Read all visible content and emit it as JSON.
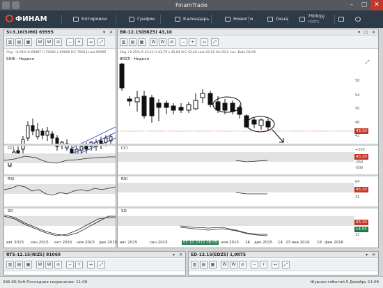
{
  "window": {
    "title": "FinamTrade",
    "min": "–",
    "max": "□",
    "close": "✕"
  },
  "toolbar": {
    "logo": "ФИНАМ",
    "items": [
      "Котировки",
      "График",
      "Календарь",
      "Новости",
      "Окна"
    ],
    "account": {
      "id": "7600qsj",
      "sub": "FORTS"
    }
  },
  "left_panel": {
    "title": "Si-3.16(SIH6) 69995",
    "info": "Chg −0,04%  O 69987  H 70062  L 69608  PrC 70023  Last 69995",
    "series": "SIH6 - Неделя",
    "y_ticks": [],
    "sub1": "CCI",
    "sub2": "RSI",
    "sub3": "SO",
    "x_ticks": [
      "авг 2015",
      "сен 2015",
      "окт 2015",
      "ноя 2015",
      "дек 2015"
    ]
  },
  "main_panel": {
    "title": "BR-12.15(BRZ5) 43,10",
    "info": "Chg +0,25%  O 43,21  H 43,79  L 42,84  PrC 43,26  Last 43,10  Vol 29,2 тыс.  Date 01/49",
    "series": "BRZ5 - Неделя",
    "price_tag": "43,10",
    "y_ticks": [
      "58",
      "54",
      "50",
      "46",
      "42"
    ],
    "sub1": {
      "name": "CCI",
      "ticks": [
        "+250",
        "-250",
        "-500"
      ],
      "tag": "43,10"
    },
    "sub2": {
      "name": "RSI",
      "ticks": [
        "64",
        "31"
      ],
      "tag": "43,10"
    },
    "sub3": {
      "name": "SO",
      "ticks": [
        "12",
        "14,55"
      ],
      "tag": "43,10",
      "tag2": "14,55"
    },
    "x_ticks": [
      "авг 2015",
      "сен 2015",
      "05.10.2015 08:09",
      "ноя 2015",
      "16",
      "дек 2015",
      "14",
      "23 янв 2016",
      "18",
      "фев 2016"
    ]
  },
  "bottom_left": {
    "title": "RTS-12.15(RIZ5) 81060"
  },
  "bottom_right": {
    "title": "ED-12.15(EDZ5) 1,0875"
  },
  "tool_labels": [
    "W",
    "W",
    "⊘",
    "↔"
  ],
  "status": {
    "left": "296 КБ  Soft  Последнее сохранение: 11:08",
    "right": "Журнал событий   5 Декабрь 11:08"
  },
  "colors": {
    "toolbar": "#2d3a48",
    "candle": "#111111",
    "channel": "#2b3fbf",
    "price_tag": "#c0392b",
    "accent_green": "#1e7a4b"
  }
}
